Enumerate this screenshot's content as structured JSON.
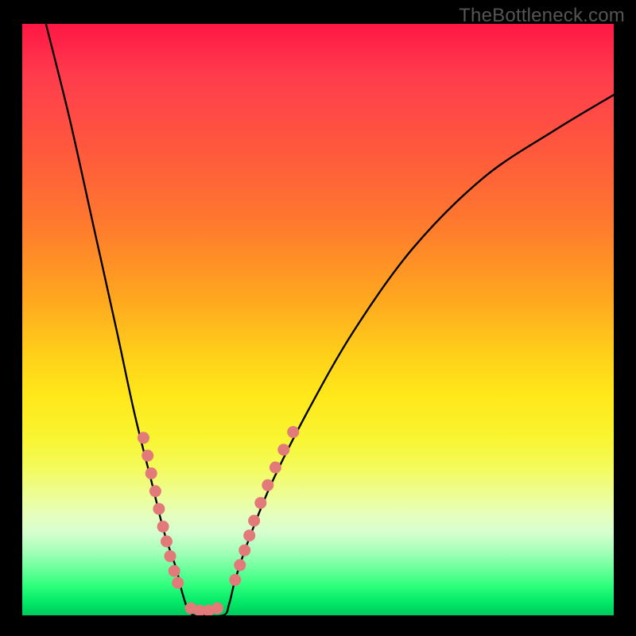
{
  "watermark": "TheBottleneck.com",
  "chart_data": {
    "type": "line",
    "title": "",
    "xlabel": "",
    "ylabel": "",
    "xlim": [
      0,
      100
    ],
    "ylim": [
      0,
      100
    ],
    "grid": false,
    "legend": false,
    "series": [
      {
        "name": "bottleneck-curve",
        "x": [
          4,
          8,
          12,
          16,
          19,
          22,
          24,
          26,
          27,
          28,
          29,
          30,
          34,
          35,
          36,
          38,
          42,
          48,
          56,
          66,
          78,
          90,
          100
        ],
        "y": [
          100,
          84,
          66,
          48,
          34,
          22,
          14,
          8,
          4,
          1,
          0,
          0,
          0,
          2,
          6,
          12,
          22,
          34,
          48,
          62,
          74,
          82,
          88
        ]
      }
    ],
    "scatter_points": {
      "left_cluster": [
        {
          "x": 20.5,
          "y": 30
        },
        {
          "x": 21.2,
          "y": 27
        },
        {
          "x": 21.8,
          "y": 24
        },
        {
          "x": 22.5,
          "y": 21
        },
        {
          "x": 23.1,
          "y": 18
        },
        {
          "x": 23.8,
          "y": 15
        },
        {
          "x": 24.4,
          "y": 12.5
        },
        {
          "x": 25.0,
          "y": 10
        },
        {
          "x": 25.7,
          "y": 7.5
        },
        {
          "x": 26.3,
          "y": 5.5
        }
      ],
      "bottom_cluster": [
        {
          "x": 28.5,
          "y": 1.2
        },
        {
          "x": 30.0,
          "y": 0.8
        },
        {
          "x": 31.5,
          "y": 0.8
        },
        {
          "x": 33.0,
          "y": 1.2
        }
      ],
      "right_cluster": [
        {
          "x": 36.0,
          "y": 6
        },
        {
          "x": 36.8,
          "y": 8.5
        },
        {
          "x": 37.6,
          "y": 11
        },
        {
          "x": 38.4,
          "y": 13.5
        },
        {
          "x": 39.2,
          "y": 16
        },
        {
          "x": 40.3,
          "y": 19
        },
        {
          "x": 41.5,
          "y": 22
        },
        {
          "x": 42.8,
          "y": 25
        },
        {
          "x": 44.2,
          "y": 28
        },
        {
          "x": 45.8,
          "y": 31
        }
      ]
    },
    "colors": {
      "curve": "#000000",
      "dots": "#e27a7a",
      "gradient_top": "#ff1744",
      "gradient_bottom": "#00c95c"
    }
  }
}
